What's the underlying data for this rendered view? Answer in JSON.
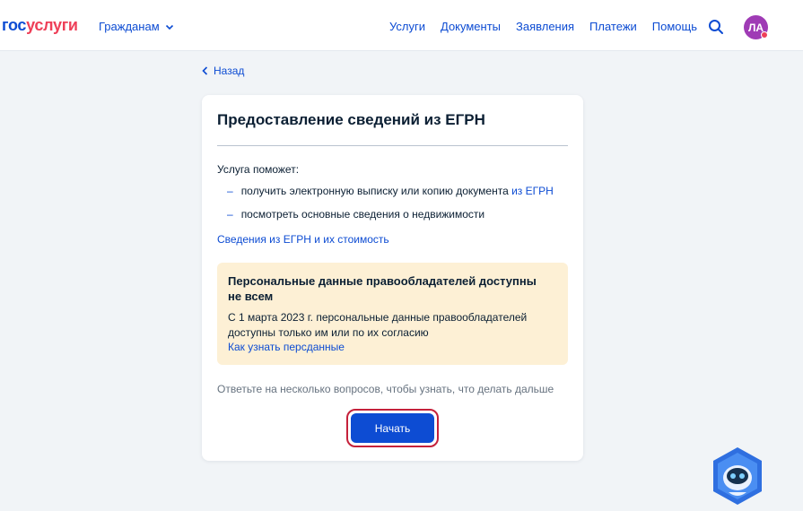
{
  "header": {
    "logo_part1": "гос",
    "logo_part2": "услуги",
    "citizens_label": "Гражданам",
    "nav": [
      "Услуги",
      "Документы",
      "Заявления",
      "Платежи",
      "Помощь"
    ],
    "avatar_initials": "ЛА"
  },
  "back_label": "Назад",
  "card": {
    "title": "Предоставление сведений из ЕГРН",
    "intro": "Услуга поможет:",
    "bullet1_text": "получить электронную выписку или копию документа ",
    "bullet1_link": "из ЕГРН",
    "bullet2_text": "посмотреть основные сведения о недвижимости",
    "info_link": "Сведения из ЕГРН и их стоимость",
    "notice": {
      "title": "Персональные данные правообладателей доступны не всем",
      "text": "С 1 марта 2023 г. персональные данные правообладателей доступны только им или по их согласию",
      "link": "Как узнать персданные"
    },
    "hint": "Ответьте на несколько вопросов, чтобы узнать, что делать дальше",
    "start_label": "Начать"
  },
  "colors": {
    "brand_blue": "#0d4cd3",
    "brand_red": "#ee3f58",
    "notice_bg": "#fdf0d5",
    "highlight_outline": "#c5213b",
    "avatar_bg": "#9f3bb5"
  }
}
